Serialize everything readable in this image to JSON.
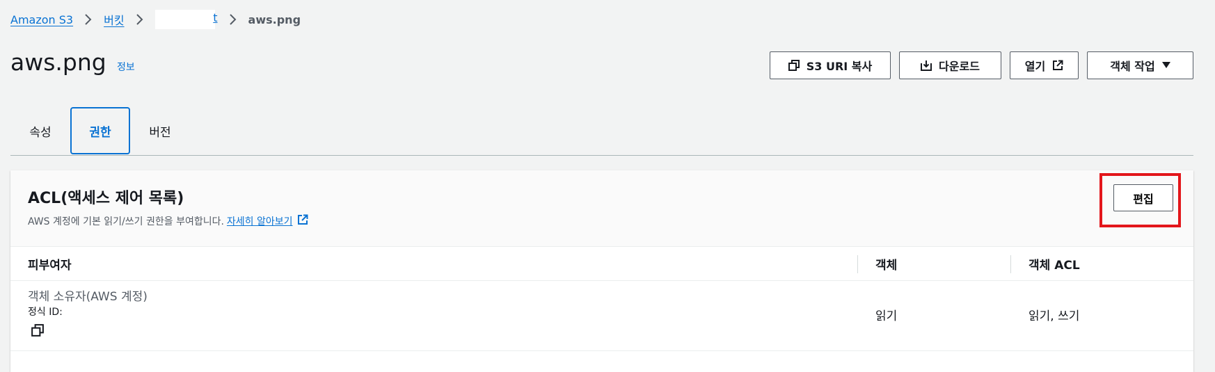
{
  "breadcrumb": {
    "root": "Amazon S3",
    "buckets": "버킷",
    "bucket_tail": "t",
    "current": "aws.png"
  },
  "header": {
    "title": "aws.png",
    "info": "정보"
  },
  "actions": {
    "copy_uri": "S3 URI 복사",
    "download": "다운로드",
    "open": "열기",
    "object_actions": "객체 작업"
  },
  "tabs": [
    {
      "label": "속성"
    },
    {
      "label": "권한",
      "active": true
    },
    {
      "label": "버전"
    }
  ],
  "acl": {
    "title": "ACL(액세스 제어 목록)",
    "description": "AWS 계정에 기본 읽기/쓰기 권한을 부여합니다.",
    "learn_more": "자세히 알아보기",
    "edit": "편집",
    "columns": [
      "피부여자",
      "객체",
      "객체 ACL"
    ],
    "rows": [
      {
        "grantee": "객체 소유자(AWS 계정)",
        "canonical_id_label": "정식 ID:",
        "object": "읽기",
        "object_acl": "읽기, 쓰기"
      }
    ]
  },
  "colors": {
    "link": "#0972d3",
    "highlight": "#e3161b",
    "background": "#f2f3f3"
  }
}
